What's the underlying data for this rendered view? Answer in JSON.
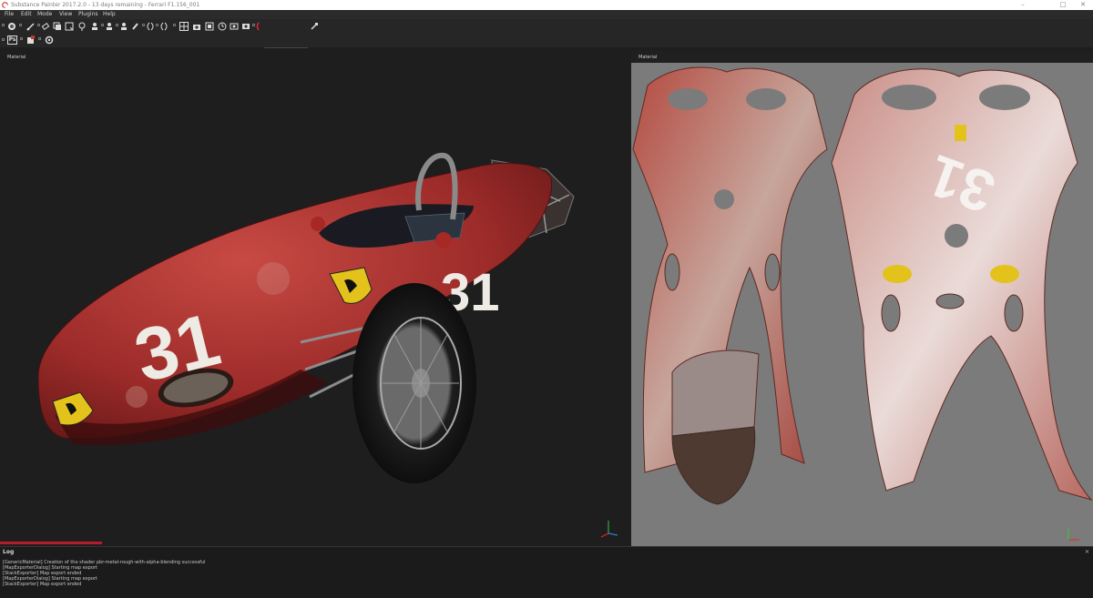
{
  "window": {
    "title": "Substance Painter 2017.2.0 - 13 days remaining - Ferrari F1.156_001",
    "minimize": "–",
    "maximize": "□",
    "close": "✕"
  },
  "menu": {
    "items": [
      "File",
      "Edit",
      "Mode",
      "View",
      "Plugins",
      "Help"
    ]
  },
  "toolbar": {
    "photoshop_label": "Ps",
    "slider_value": "0"
  },
  "viewport_3d": {
    "label": "Material",
    "car_number": "31"
  },
  "viewport_2d": {
    "label": "Material",
    "uv_number": "31"
  },
  "log": {
    "title": "Log",
    "close": "✕",
    "lines": [
      "[GenericMaterial] Creation of the shader pbr-metal-rough-with-alpha-blending successful",
      "[MapExporterDialog] Starting map export",
      "[StackExporter] Map export ended",
      "[MapExporterDialog] Starting map export",
      "[StackExporter] Map export ended"
    ]
  },
  "colors": {
    "accent": "#b21f2a",
    "car_red": "#b4312e",
    "uv_background": "#7b7b7b",
    "ferrari_yellow": "#e3c21b"
  }
}
